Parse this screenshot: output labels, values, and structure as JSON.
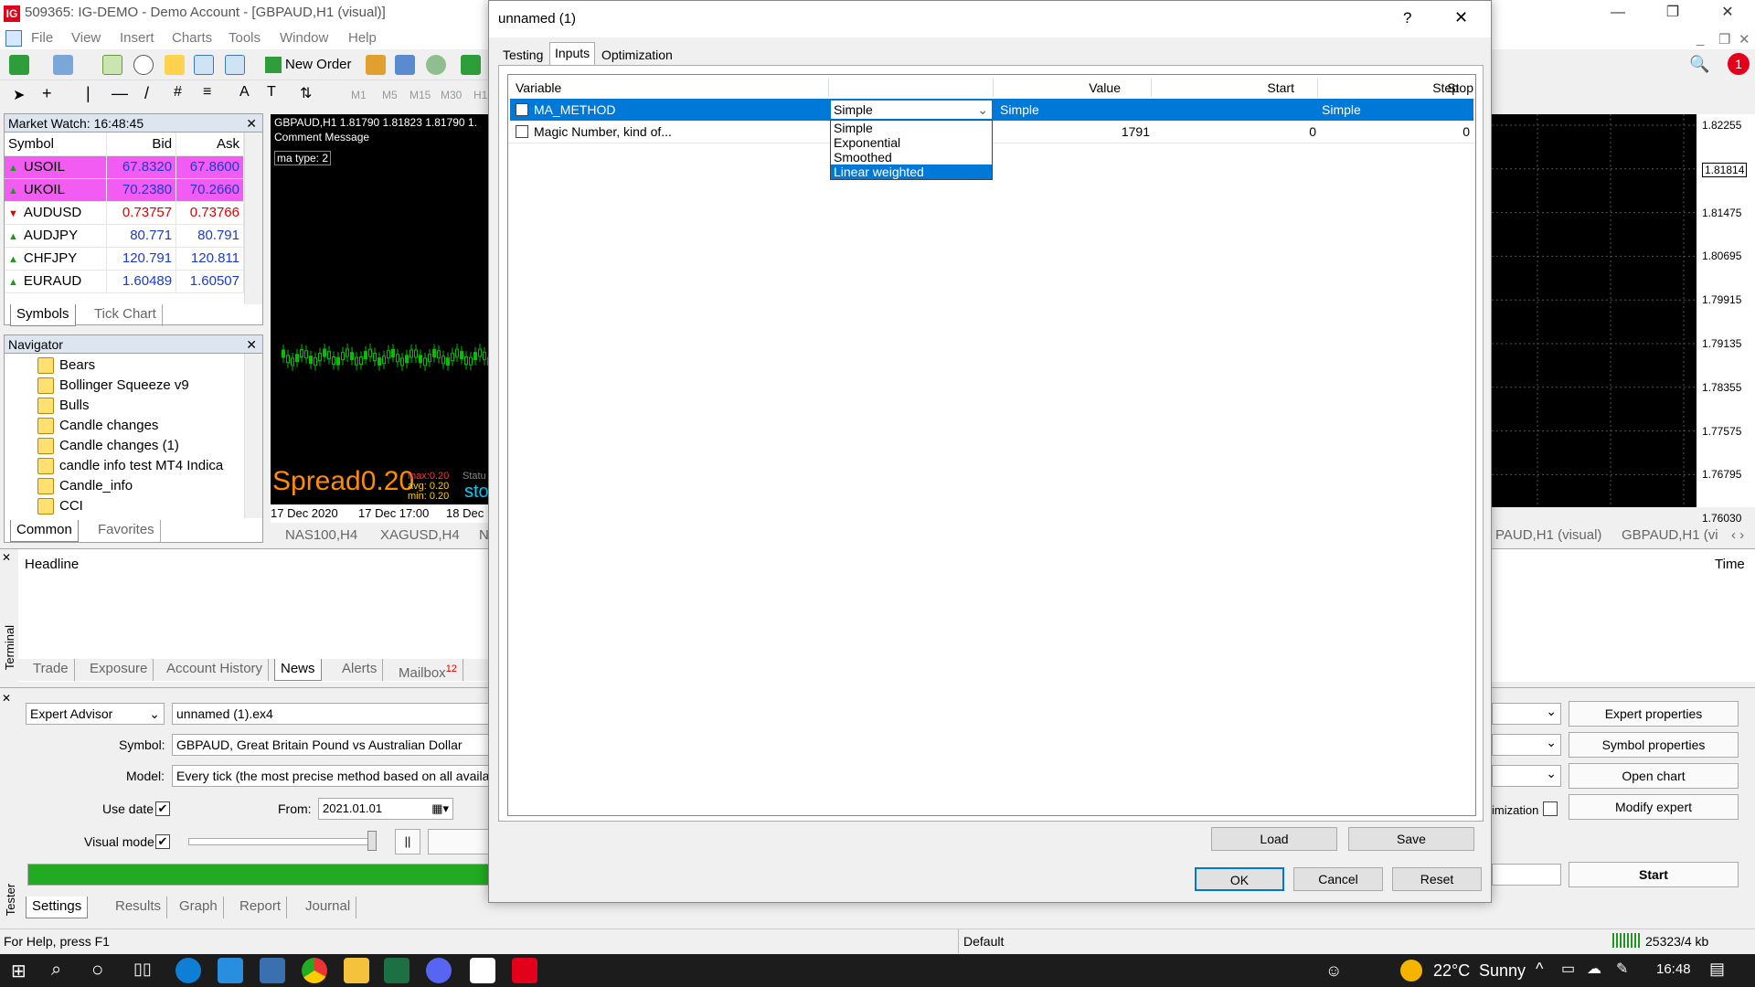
{
  "window": {
    "title": "509365: IG-DEMO - Demo Account - [GBPAUD,H1 (visual)]",
    "logo_text": "IG"
  },
  "menu": [
    "File",
    "View",
    "Insert",
    "Charts",
    "Tools",
    "Window",
    "Help"
  ],
  "toolbar": {
    "new_order": "New Order",
    "timeframes": [
      "M1",
      "M5",
      "M15",
      "M30",
      "H1"
    ]
  },
  "market_watch": {
    "title": "Market Watch: 16:48:45",
    "headers": [
      "Symbol",
      "Bid",
      "Ask"
    ],
    "rows": [
      {
        "symbol": "USOIL",
        "bid": "67.8320",
        "ask": "67.8600",
        "dir": "up",
        "hl": true
      },
      {
        "symbol": "UKOIL",
        "bid": "70.2380",
        "ask": "70.2660",
        "dir": "up",
        "hl": true
      },
      {
        "symbol": "AUDUSD",
        "bid": "0.73757",
        "ask": "0.73766",
        "dir": "dn",
        "hl": false
      },
      {
        "symbol": "AUDJPY",
        "bid": "80.771",
        "ask": "80.791",
        "dir": "up",
        "hl": false
      },
      {
        "symbol": "CHFJPY",
        "bid": "120.791",
        "ask": "120.811",
        "dir": "up",
        "hl": false
      },
      {
        "symbol": "EURAUD",
        "bid": "1.60489",
        "ask": "1.60507",
        "dir": "up",
        "hl": false
      }
    ],
    "tabs": [
      "Symbols",
      "Tick Chart"
    ]
  },
  "navigator": {
    "title": "Navigator",
    "items": [
      "Bears",
      "Bollinger Squeeze v9",
      "Bulls",
      "Candle changes",
      "Candle changes (1)",
      "candle info test MT4 Indica",
      "Candle_info",
      "CCI"
    ],
    "tabs": [
      "Common",
      "Favorites"
    ]
  },
  "chart": {
    "header": "GBPAUD,H1  1.81790 1.81823 1.81790 1.",
    "comment": "Comment Message",
    "ma_type": "ma type: 2",
    "spread_label": "Spread",
    "spread_value": "0.20",
    "max": "max:0.20",
    "avg": "avg: 0.20",
    "min": "min: 0.20",
    "status": "Statu",
    "sto": "sto",
    "dates": [
      "17 Dec 2020",
      "17 Dec 17:00",
      "18 Dec"
    ],
    "prices": [
      "1.82255",
      "1.81814",
      "1.81475",
      "1.80695",
      "1.79915",
      "1.79135",
      "1.78355",
      "1.77575",
      "1.76795",
      "1.76030"
    ],
    "tabs": [
      "NAS100,H4",
      "XAGUSD,H4",
      "N"
    ],
    "tabs_right": [
      "PAUD,H1 (visual)",
      "GBPAUD,H1 (vi"
    ]
  },
  "dialog": {
    "title": "unnamed (1)",
    "help": "?",
    "close": "✕",
    "tabs": [
      "Testing",
      "Inputs",
      "Optimization"
    ],
    "active_tab": "Inputs",
    "headers": {
      "variable": "Variable",
      "value": "Value",
      "start": "Start",
      "step": "Step",
      "stop": "Stop"
    },
    "rows": [
      {
        "variable": "MA_METHOD",
        "value": "Simple",
        "start": "Simple",
        "step": "",
        "stop": "Simple"
      },
      {
        "variable": "Magic Number, kind of...",
        "value": "",
        "start": "1791",
        "step": "0",
        "stop": "0"
      }
    ],
    "dropdown_options": [
      "Simple",
      "Exponential",
      "Smoothed",
      "Linear weighted"
    ],
    "dropdown_highlight": "Linear weighted",
    "buttons": {
      "load": "Load",
      "save": "Save",
      "ok": "OK",
      "cancel": "Cancel",
      "reset": "Reset"
    }
  },
  "terminal": {
    "headline": "Headline",
    "time": "Time",
    "side_label": "Terminal",
    "tabs": [
      "Trade",
      "Exposure",
      "Account History",
      "News",
      "Alerts",
      "Mailbox"
    ],
    "mailbox_count": "12",
    "active_tab": "News"
  },
  "tester": {
    "side_label": "Tester",
    "type": "Expert Advisor",
    "file": "unnamed (1).ex4",
    "symbol_label": "Symbol:",
    "symbol": "GBPAUD, Great Britain Pound vs Australian Dollar",
    "model_label": "Model:",
    "model": "Every tick (the most precise method based on all availabl",
    "use_date": "Use date",
    "from_label": "From:",
    "from": "2021.01.01",
    "visual_mode": "Visual mode",
    "pause": "||",
    "optimization": "imization",
    "buttons": {
      "expert": "Expert properties",
      "symbol": "Symbol properties",
      "open_chart": "Open chart",
      "modify": "Modify expert",
      "start": "Start"
    },
    "tabs": [
      "Settings",
      "Results",
      "Graph",
      "Report",
      "Journal"
    ],
    "progress": 1.0
  },
  "statusbar": {
    "help": "For Help, press F1",
    "profile": "Default",
    "traffic": "25323/4 kb"
  },
  "taskbar": {
    "temp": "22°C",
    "weather": "Sunny",
    "time": "16:48",
    "notification_count": "1"
  },
  "colors": {
    "highlight": "#0078d7",
    "market_highlight": "#f35cf3",
    "progress": "#22aa22",
    "spread": "#ff8c00"
  }
}
